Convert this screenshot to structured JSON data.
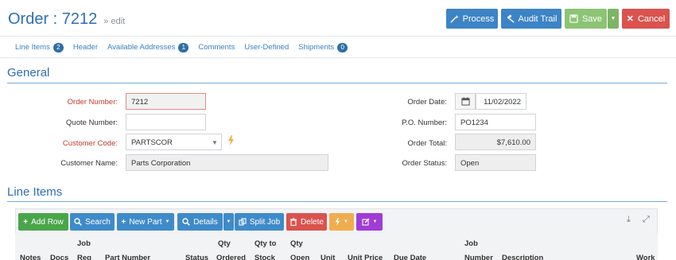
{
  "header": {
    "title": "Order : 7212",
    "edit_link": "» edit",
    "buttons": {
      "process": "Process",
      "audit_trail": "Audit Trail",
      "save": "Save",
      "cancel": "Cancel"
    }
  },
  "tabs": [
    {
      "label": "Line Items",
      "badge": "2"
    },
    {
      "label": "Header",
      "badge": ""
    },
    {
      "label": "Available Addresses",
      "badge": "1"
    },
    {
      "label": "Comments",
      "badge": ""
    },
    {
      "label": "User-Defined",
      "badge": ""
    },
    {
      "label": "Shipments",
      "badge": "0"
    }
  ],
  "general": {
    "title": "General",
    "order_number_label": "Order Number:",
    "order_number": "7212",
    "quote_number_label": "Quote Number:",
    "quote_number": "",
    "customer_code_label": "Customer Code:",
    "customer_code": "PARTSCOR",
    "customer_name_label": "Customer Name:",
    "customer_name": "Parts Corporation",
    "order_date_label": "Order Date:",
    "order_date": "11/02/2022",
    "po_number_label": "P.O. Number:",
    "po_number": "PO1234",
    "order_total_label": "Order Total:",
    "order_total": "$7,610.00",
    "order_status_label": "Order Status:",
    "order_status": "Open"
  },
  "line_items": {
    "title": "Line Items",
    "toolbar": {
      "add_row": "Add Row",
      "search": "Search",
      "new_part": "New Part",
      "details": "Details",
      "split_job": "Split Job",
      "delete": "Delete"
    },
    "columns": {
      "notes": "Notes",
      "docs": "Docs",
      "job_req_1": "Job",
      "job_req_2": "Req",
      "part_number": "Part Number",
      "status": "Status",
      "qty_ordered_1": "Qty",
      "qty_ordered_2": "Ordered",
      "qty_to_stock_1": "Qty to",
      "qty_to_stock_2": "Stock",
      "qty_open_1": "Qty",
      "qty_open_2": "Open",
      "unit": "Unit",
      "unit_price": "Unit Price",
      "due_date": "Due Date",
      "job_number_1": "Job",
      "job_number_2": "Number",
      "description": "Description",
      "work": "Work"
    }
  },
  "colors": {
    "primary": "#3d84c6",
    "success": "#8cc474",
    "danger": "#d9534f",
    "warning": "#f0ad4e",
    "purple": "#a03bd6",
    "title": "#2d6fb4"
  }
}
